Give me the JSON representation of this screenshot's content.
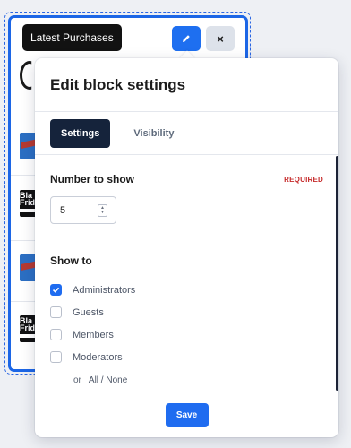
{
  "widget": {
    "title": "Latest Purchases",
    "edit_icon": "pencil-icon",
    "close_label": "×",
    "thumb_text": "Bla\nFrid"
  },
  "popup": {
    "title": "Edit block settings",
    "tabs": [
      {
        "label": "Settings",
        "active": true
      },
      {
        "label": "Visibility",
        "active": false
      }
    ],
    "number_to_show": {
      "label": "Number to show",
      "required_label": "REQUIRED",
      "value": "5"
    },
    "show_to": {
      "label": "Show to",
      "options": [
        {
          "label": "Administrators",
          "checked": true
        },
        {
          "label": "Guests",
          "checked": false
        },
        {
          "label": "Members",
          "checked": false
        },
        {
          "label": "Moderators",
          "checked": false
        }
      ],
      "or_text": "or",
      "all_none_text": "All / None"
    },
    "save_label": "Save"
  },
  "colors": {
    "accent": "#1f6cf0",
    "tab_active_bg": "#15233b",
    "required": "#c62a2a",
    "widget_border": "#1c66e6"
  }
}
